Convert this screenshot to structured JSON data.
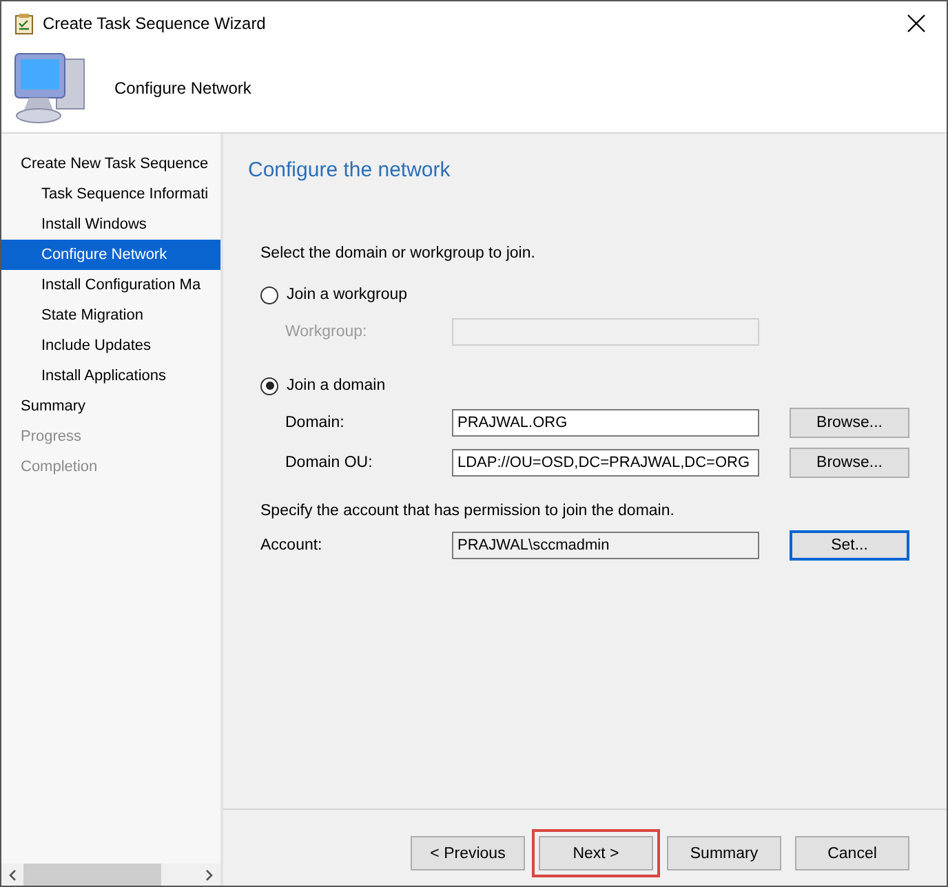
{
  "window": {
    "title": "Create Task Sequence Wizard"
  },
  "header": {
    "title": "Configure Network"
  },
  "sidebar": {
    "items": [
      {
        "label": "Create New Task Sequence",
        "selected": false,
        "disabled": false,
        "children": [
          {
            "label": "Task Sequence Informati",
            "selected": false,
            "disabled": false
          },
          {
            "label": "Install Windows",
            "selected": false,
            "disabled": false
          },
          {
            "label": "Configure Network",
            "selected": true,
            "disabled": false
          },
          {
            "label": "Install Configuration Ma",
            "selected": false,
            "disabled": false
          },
          {
            "label": "State Migration",
            "selected": false,
            "disabled": false
          },
          {
            "label": "Include Updates",
            "selected": false,
            "disabled": false
          },
          {
            "label": "Install Applications",
            "selected": false,
            "disabled": false
          }
        ]
      },
      {
        "label": "Summary",
        "selected": false,
        "disabled": false
      },
      {
        "label": "Progress",
        "selected": false,
        "disabled": true
      },
      {
        "label": "Completion",
        "selected": false,
        "disabled": true
      }
    ]
  },
  "page": {
    "heading": "Configure the network",
    "intro": "Select the domain or workgroup to join.",
    "options": [
      {
        "label": "Join a workgroup",
        "selected": false,
        "fields": [
          {
            "label": "Workgroup:",
            "disabled": true
          }
        ]
      },
      {
        "label": "Join a domain",
        "selected": true,
        "fields": [
          {
            "label": "Domain:",
            "value": "PRAJWAL.ORG",
            "disabled": false,
            "button": "Browse..."
          },
          {
            "label": "Domain OU:",
            "value": "LDAP://OU=OSD,DC=PRAJWAL,DC=ORG",
            "disabled": false,
            "button": "Browse..."
          }
        ]
      }
    ],
    "account_note": "Specify the account that has permission to join the domain.",
    "account": {
      "label": "Account:",
      "value": "PRAJWAL\\sccmadmin",
      "button": "Set..."
    }
  },
  "buttons": [
    {
      "label": "< Previous",
      "highlighted": false
    },
    {
      "label": "Next >",
      "highlighted": true
    },
    {
      "label": "Summary",
      "highlighted": false
    },
    {
      "label": "Cancel",
      "highlighted": false
    }
  ]
}
